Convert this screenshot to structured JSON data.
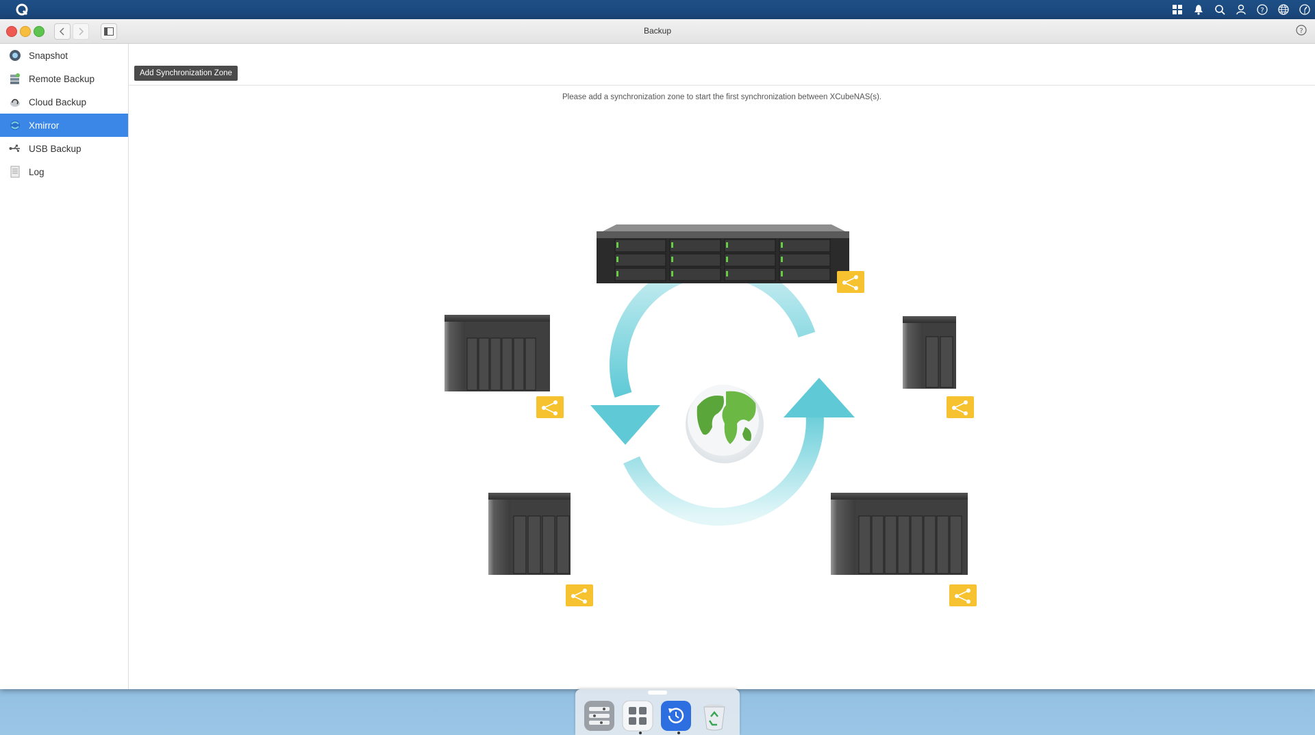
{
  "window": {
    "title": "Backup"
  },
  "sidebar": {
    "items": [
      {
        "label": "Snapshot",
        "icon": "snapshot-icon"
      },
      {
        "label": "Remote Backup",
        "icon": "remote-backup-icon"
      },
      {
        "label": "Cloud Backup",
        "icon": "cloud-backup-icon"
      },
      {
        "label": "Xmirror",
        "icon": "xmirror-icon",
        "active": true
      },
      {
        "label": "USB Backup",
        "icon": "usb-icon"
      },
      {
        "label": "Log",
        "icon": "log-icon"
      }
    ]
  },
  "toolbar": {
    "add_label": "Add Synchronization Zone"
  },
  "main": {
    "message": "Please add a synchronization zone to start the first synchronization between XCubeNAS(s)."
  },
  "topbar_icons": [
    "apps-icon",
    "bell-icon",
    "search-icon",
    "user-icon",
    "help-icon",
    "globe-icon",
    "dashboard-icon"
  ],
  "dock": {
    "apps": [
      "control-panel-icon",
      "app-center-icon",
      "backup-app-icon",
      "recycle-bin-icon"
    ]
  },
  "colors": {
    "accent": "#3a87e8",
    "topbar": "#1d4f86",
    "share": "#f7c22f",
    "sync_arrow": "#5fcad6"
  }
}
